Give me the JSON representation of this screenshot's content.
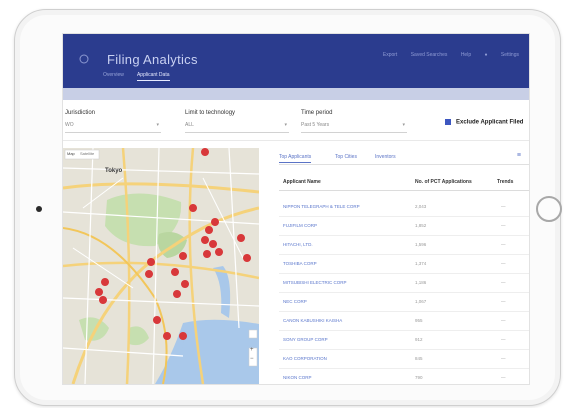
{
  "app": {
    "title": "Filing Analytics",
    "header_tabs": [
      "Overview",
      "Applicant Data"
    ],
    "active_tab_index": 1,
    "header_right": [
      "Export",
      "Saved Searches",
      "Help",
      "Settings"
    ]
  },
  "filters": {
    "jurisdiction": {
      "label": "Jurisdiction",
      "value": "WO"
    },
    "technology": {
      "label": "Limit to technology",
      "value": "ALL"
    },
    "time_period": {
      "label": "Time period",
      "value": "Past 5 Years"
    },
    "exclude_label": "Exclude Applicant Filed",
    "exclude_checked": true
  },
  "map": {
    "view_buttons": [
      "Map",
      "Satellite"
    ],
    "city_label": "Tokyo",
    "marker_count": 22,
    "colors": {
      "land": "#e6e3d8",
      "park": "#c6dfb0",
      "water": "#a9c8ea",
      "road": "#f5d27a",
      "marker": "#d8383a"
    }
  },
  "table": {
    "tabs": [
      "Top Applicants",
      "Top Cities",
      "Inventors"
    ],
    "active_tab_index": 0,
    "columns": [
      "Applicant Name",
      "No. of PCT Applications",
      "Trends"
    ],
    "rows": [
      {
        "name": "NIPPON TELEGRAPH & TELE CORP",
        "count": "2,043",
        "trend": "—"
      },
      {
        "name": "FUJIFILM CORP",
        "count": "1,852",
        "trend": "—"
      },
      {
        "name": "HITACHI, LTD.",
        "count": "1,596",
        "trend": "—"
      },
      {
        "name": "TOSHIBA CORP",
        "count": "1,374",
        "trend": "—"
      },
      {
        "name": "MITSUBISHI ELECTRIC CORP",
        "count": "1,186",
        "trend": "—"
      },
      {
        "name": "NEC CORP",
        "count": "1,067",
        "trend": "—"
      },
      {
        "name": "CANON KABUSHIKI KAISHA",
        "count": "955",
        "trend": "—"
      },
      {
        "name": "SONY GROUP CORP",
        "count": "912",
        "trend": "—"
      },
      {
        "name": "KAO CORPORATION",
        "count": "845",
        "trend": "—"
      },
      {
        "name": "NIKON CORP",
        "count": "790",
        "trend": "—"
      }
    ]
  },
  "accent": "#2b3c8e"
}
